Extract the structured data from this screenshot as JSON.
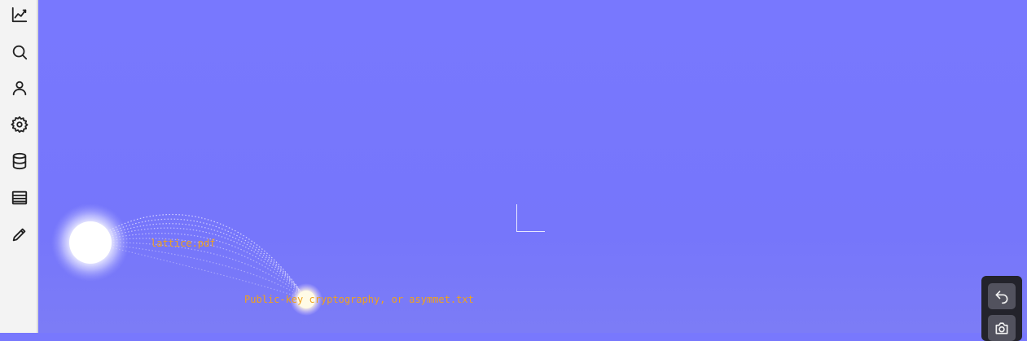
{
  "sidebar": {
    "items": [
      {
        "name": "chart-line-icon"
      },
      {
        "name": "search-icon"
      },
      {
        "name": "user-icon"
      },
      {
        "name": "gear-icon"
      },
      {
        "name": "database-icon"
      },
      {
        "name": "list-icon"
      },
      {
        "name": "pencil-icon"
      }
    ]
  },
  "graph": {
    "nodes": [
      {
        "label": "lattice.pdf"
      },
      {
        "label": "Public-key cryptography, or asymmet.txt"
      }
    ]
  },
  "toolbar": {
    "items": [
      {
        "name": "undo-icon"
      },
      {
        "name": "camera-icon"
      }
    ]
  },
  "colors": {
    "background": "#7878fd",
    "label": "#f0a21d",
    "sidebar": "#f3f3f3",
    "toolbar": "#23232b"
  }
}
